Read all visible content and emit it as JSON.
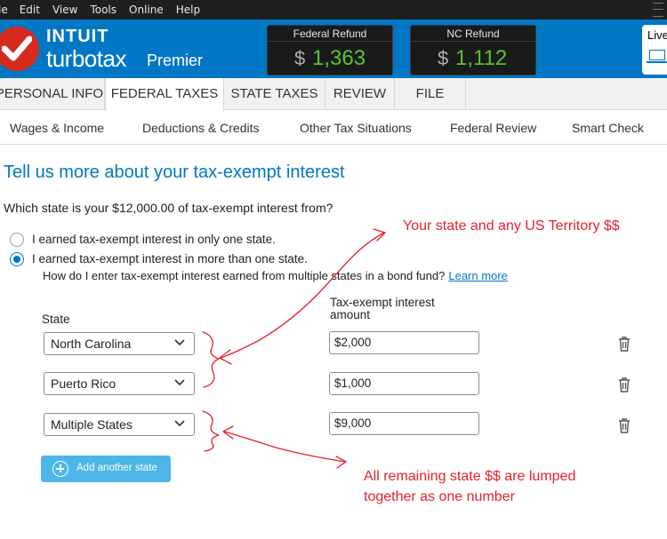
{
  "menu": [
    "le",
    "Edit",
    "View",
    "Tools",
    "Online",
    "Help"
  ],
  "header": {
    "brand_top": "INTUIT",
    "brand_main": "turbotax",
    "brand_edition": "Premier",
    "federal_refund": {
      "label": "Federal Refund",
      "currency": "$",
      "value": "1,363"
    },
    "nc_refund": {
      "label": "NC Refund",
      "currency": "$",
      "value": "1,112"
    },
    "live_label": "Live"
  },
  "tabs": [
    "PERSONAL INFO",
    "FEDERAL TAXES",
    "STATE TAXES",
    "REVIEW",
    "FILE"
  ],
  "active_tab": "FEDERAL TAXES",
  "subnav": [
    "Wages & Income",
    "Deductions & Credits",
    "Other Tax Situations",
    "Federal Review",
    "Smart Check"
  ],
  "page": {
    "title": "Tell us more about your tax-exempt interest",
    "question": "Which state is your $12,000.00 of tax-exempt interest from?",
    "options": [
      {
        "label": "I earned tax-exempt interest in only one state.",
        "selected": false
      },
      {
        "label": "I earned tax-exempt interest in more than one state.",
        "selected": true
      }
    ],
    "help_text": "How do I enter tax-exempt interest earned from multiple states in a bond fund?",
    "help_link": "Learn more",
    "col_state": "State",
    "col_amount_line1": "Tax-exempt interest",
    "col_amount_line2": "amount",
    "rows": [
      {
        "state": "North Carolina",
        "amount": "$2,000"
      },
      {
        "state": "Puerto Rico",
        "amount": "$1,000"
      },
      {
        "state": "Multiple States",
        "amount": "$9,000"
      }
    ],
    "add_button": "Add another state"
  },
  "annotations": {
    "top": "Your state and any US Territory $$",
    "bottom_line1": "All remaining state $$ are lumped",
    "bottom_line2": "together as one number"
  },
  "colors": {
    "header_blue": "#0077c5",
    "refund_green": "#5cc12e",
    "annotation_red": "#e8202a",
    "add_button": "#4db6e8"
  }
}
